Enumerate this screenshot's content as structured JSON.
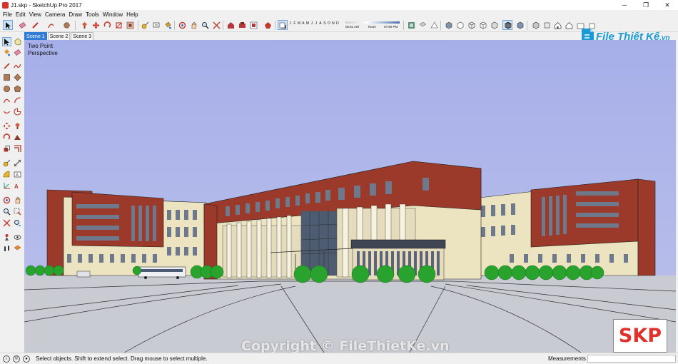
{
  "window": {
    "title": "J1.skp - SketchUp Pro 2017",
    "minimize": "─",
    "maximize": "❐",
    "close": "✕"
  },
  "menu": [
    "File",
    "Edit",
    "View",
    "Camera",
    "Draw",
    "Tools",
    "Window",
    "Help"
  ],
  "shadows": {
    "months": [
      "J",
      "F",
      "M",
      "A",
      "M",
      "J",
      "J",
      "A",
      "S",
      "O",
      "N",
      "D"
    ],
    "time_start": "06:51 AM",
    "time_mid": "Noon",
    "time_end": "07:50 PM"
  },
  "brand": {
    "name": "File Thiết Kế",
    "suffix": ".vn",
    "logo_color": "#1b9ad6"
  },
  "scenes": [
    "Scene 1",
    "Scene 2",
    "Scene 3"
  ],
  "active_scene": "Scene 1",
  "viewport": {
    "camera_label_line1": "Two Point",
    "camera_label_line2": "Perspective",
    "sky_color": "#a9b3ea",
    "ground_color": "#c9ccd4"
  },
  "watermark": "Copyright © FileThietKe.vn",
  "badge": "SKP",
  "status": {
    "message": "Select objects. Shift to extend select. Drag mouse to select multiple.",
    "measurements_label": "Measurements",
    "measurements_value": ""
  },
  "toolbar_icons": [
    "select-icon",
    "eraser-icon",
    "pencil-icon",
    "arc-icon",
    "shapes-icon",
    "pushpull-icon",
    "move-icon",
    "rotate-icon",
    "scale-icon",
    "offset-icon",
    "tape-icon",
    "text-icon",
    "paint-icon",
    "orbit-icon",
    "pan-icon",
    "zoom-icon",
    "zoom-extents-icon",
    "warehouse-icon",
    "extension-icon",
    "component-icon",
    "shadow-toggle-icon",
    "fog-icon",
    "section-icon",
    "xray-icon",
    "wireframe-icon",
    "hidden-line-icon",
    "shaded-icon",
    "textured-icon",
    "monochrome-icon",
    "iso-view-icon",
    "top-view-icon",
    "front-view-icon",
    "right-view-icon",
    "back-view-icon",
    "left-view-icon"
  ],
  "left_tools": [
    "select-icon",
    "component-icon",
    "eraser-icon",
    "paint-icon",
    "pencil-icon",
    "freehand-icon",
    "rectangle-icon",
    "rotated-rect-icon",
    "circle-icon",
    "polygon-icon",
    "arc-icon",
    "pie-icon",
    "move-icon",
    "pushpull-icon",
    "rotate-icon",
    "followme-icon",
    "scale-icon",
    "offset-icon",
    "tape-icon",
    "dimension-icon",
    "protractor-icon",
    "text-icon",
    "axes-icon",
    "3dtext-icon",
    "orbit-icon",
    "pan-icon",
    "zoom-icon",
    "zoom-window-icon",
    "zoom-extents-icon",
    "previous-icon",
    "position-camera-icon",
    "lookaround-icon",
    "walk-icon",
    "section-plane-icon"
  ]
}
